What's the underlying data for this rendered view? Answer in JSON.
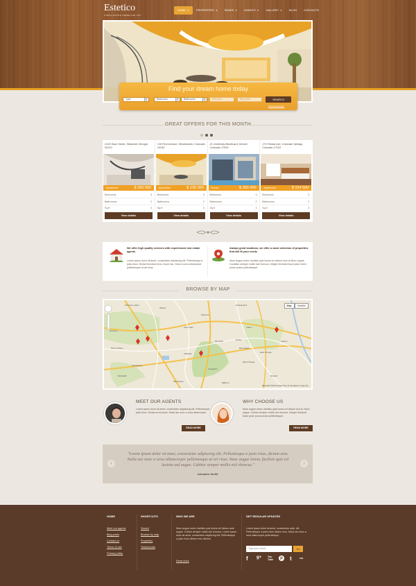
{
  "header": {
    "logo": "Estetico",
    "tagline": "A REAL ESTATE THEME FOR YOU",
    "nav": [
      {
        "label": "HOME",
        "dropdown": true,
        "active": true
      },
      {
        "label": "PROPERTIES",
        "dropdown": true
      },
      {
        "label": "PAGES",
        "dropdown": true
      },
      {
        "label": "AGENTS",
        "dropdown": true
      },
      {
        "label": "GALLERY",
        "dropdown": true
      },
      {
        "label": "BLOG"
      },
      {
        "label": "CONTACTS"
      }
    ]
  },
  "search": {
    "title": "Find your dream home today",
    "type": "Type",
    "bedrooms": "Bedrooms",
    "bathrooms": "Bathrooms",
    "min_price": "Min price",
    "max_price": "Max price",
    "button": "SEARCH",
    "advanced": "Advanced search"
  },
  "offers": {
    "title": "GREAT OFFERS FOR THIS MONTH",
    "cards": [
      {
        "address": "2126 Sami Street, Steamish Georgia 00210",
        "kind": "Apartment",
        "price": "$ 250 000",
        "bedrooms": "3",
        "bathrooms": "2",
        "sqft": "3",
        "button": "View details"
      },
      {
        "address": "135 First Avenue, Westminster, Colorado 15240",
        "kind": "Apartment",
        "price": "$ 135 000",
        "bedrooms": "3",
        "bathrooms": "2",
        "sqft": "3",
        "button": "View details"
      },
      {
        "address": "21 University Boulevard, Denver, Colorado 17000",
        "kind": "House",
        "price": "$ 350 000",
        "bedrooms": "3",
        "bathrooms": "2",
        "sqft": "3",
        "button": "View details"
      },
      {
        "address": "170 Florida Ave, Colorado Springs, Colorado 17110",
        "kind": "Apartment",
        "price": "$ 154 500",
        "bedrooms": "3",
        "bathrooms": "2",
        "sqft": "3",
        "button": "View details"
      }
    ],
    "row_labels": {
      "bedrooms": "Bedrooms",
      "bathrooms": "Bathrooms",
      "sqft": "Sq.ft"
    }
  },
  "features": [
    {
      "title": "We offer high quality services with experienced real estate agents",
      "text": "Lorem ipsum dolor sit amet, consectetur adipiscing elit. Pellentesque a justo risus. Dictum tincidunt eros, fusce nec. Nunc a urna ullamcorper pellentesque at vel risus."
    },
    {
      "title": "Always great locations, we offer a vaste selection of properties that will fit your needs",
      "text": "Nunc augue lorem, facilisis quis luctus vel dictum eros at Nunc augue. Curabitur semper mollis nisl rhoncus. Integer tincidunt fusce justo lorem purus auctor pellentesque."
    }
  ],
  "map": {
    "title": "BROWSE BY MAP",
    "btn_map": "Map",
    "btn_satellite": "Satellite",
    "places": [
      "Pompton Lakes",
      "Ringwood",
      "Wayne",
      "Paterson",
      "Passaic",
      "Little Falls",
      "Bloomfield",
      "Nutley",
      "Montclair",
      "West Orange",
      "Livingston",
      "East Orange",
      "Newark",
      "Millburn",
      "Springfield",
      "Summit",
      "Kearny",
      "Hackensack",
      "Clifton",
      "Caldwell",
      "Cedar Grove",
      "Morris Plains",
      "Parsippany",
      "Wharton",
      "Kinnelon",
      "Randolph",
      "Morristown"
    ],
    "footer": "Map data ©2013 Google  Terms of Use  Report a map error"
  },
  "agents": {
    "title": "MEET OUR AGENTS",
    "text": "Lorem ipsum dolor sit amet, consectetur adipiscing elit. Pellentesque justo risus. Dictum eros fusce. Nulla nec nunc a urna ullamcorper.",
    "button": "READ MORE"
  },
  "why": {
    "title": "WHY CHOOSE US",
    "text": "Nunc augue lorem, facilisis quis luctus vel dictum sed at. Nunc augue. Cubitur semper mollis nisl rhoncus. Integer tincidunt fusce justo purus auctor pellentesque.",
    "button": "READ MORE"
  },
  "testimonial": {
    "text": "\"Lorem ipsum dolor sit amet, consectetur adipiscing elit. Pellentesque a justo risus, dictum eros. Nulla nec nunc a urna ullamcorper pellentesque at vel risus. Nunc augue lorem, facilisis quis vel lacinia sed augue. Cubitur semper mollis nisl rhoncus.\"",
    "author": "Johnaton Smith"
  },
  "footer": {
    "home": {
      "title": "HOME",
      "links": [
        "Meet our agents",
        "Blog posts",
        "Contact us",
        "Terms of use",
        "Privacy policy"
      ]
    },
    "shortcuts": {
      "title": "SHORTCUTS",
      "links": [
        "Search",
        "Browse by map",
        "Properties",
        "Testimonials"
      ]
    },
    "who": {
      "title": "WHO WE ARE",
      "text": "Nunc augue lorem, facilisis quis luctus vel dictum ante augue. Cubitur semper mollis nisl rhoncus. Lorem ipsum dolor sit amet, consectetur adipiscing elit. Pellentesque a justo risus dictum eros ultrices.",
      "more": "Read more"
    },
    "updates": {
      "title": "GET REGULAR UPDATES",
      "text": "Lorem ipsum dolor sit amet, consectetur adip. elit. Pellentesque a justo risus dictum eros. Nulla nec nunc a urna ullamcorper pellentesque.",
      "placeholder": "Type your email",
      "go": "Go"
    },
    "social": [
      "f",
      "g+",
      "You Tube",
      "p",
      "t",
      "rss"
    ]
  },
  "colors": {
    "accent": "#e8a533",
    "brown": "#5e3b24",
    "footer": "#5a3b29"
  }
}
